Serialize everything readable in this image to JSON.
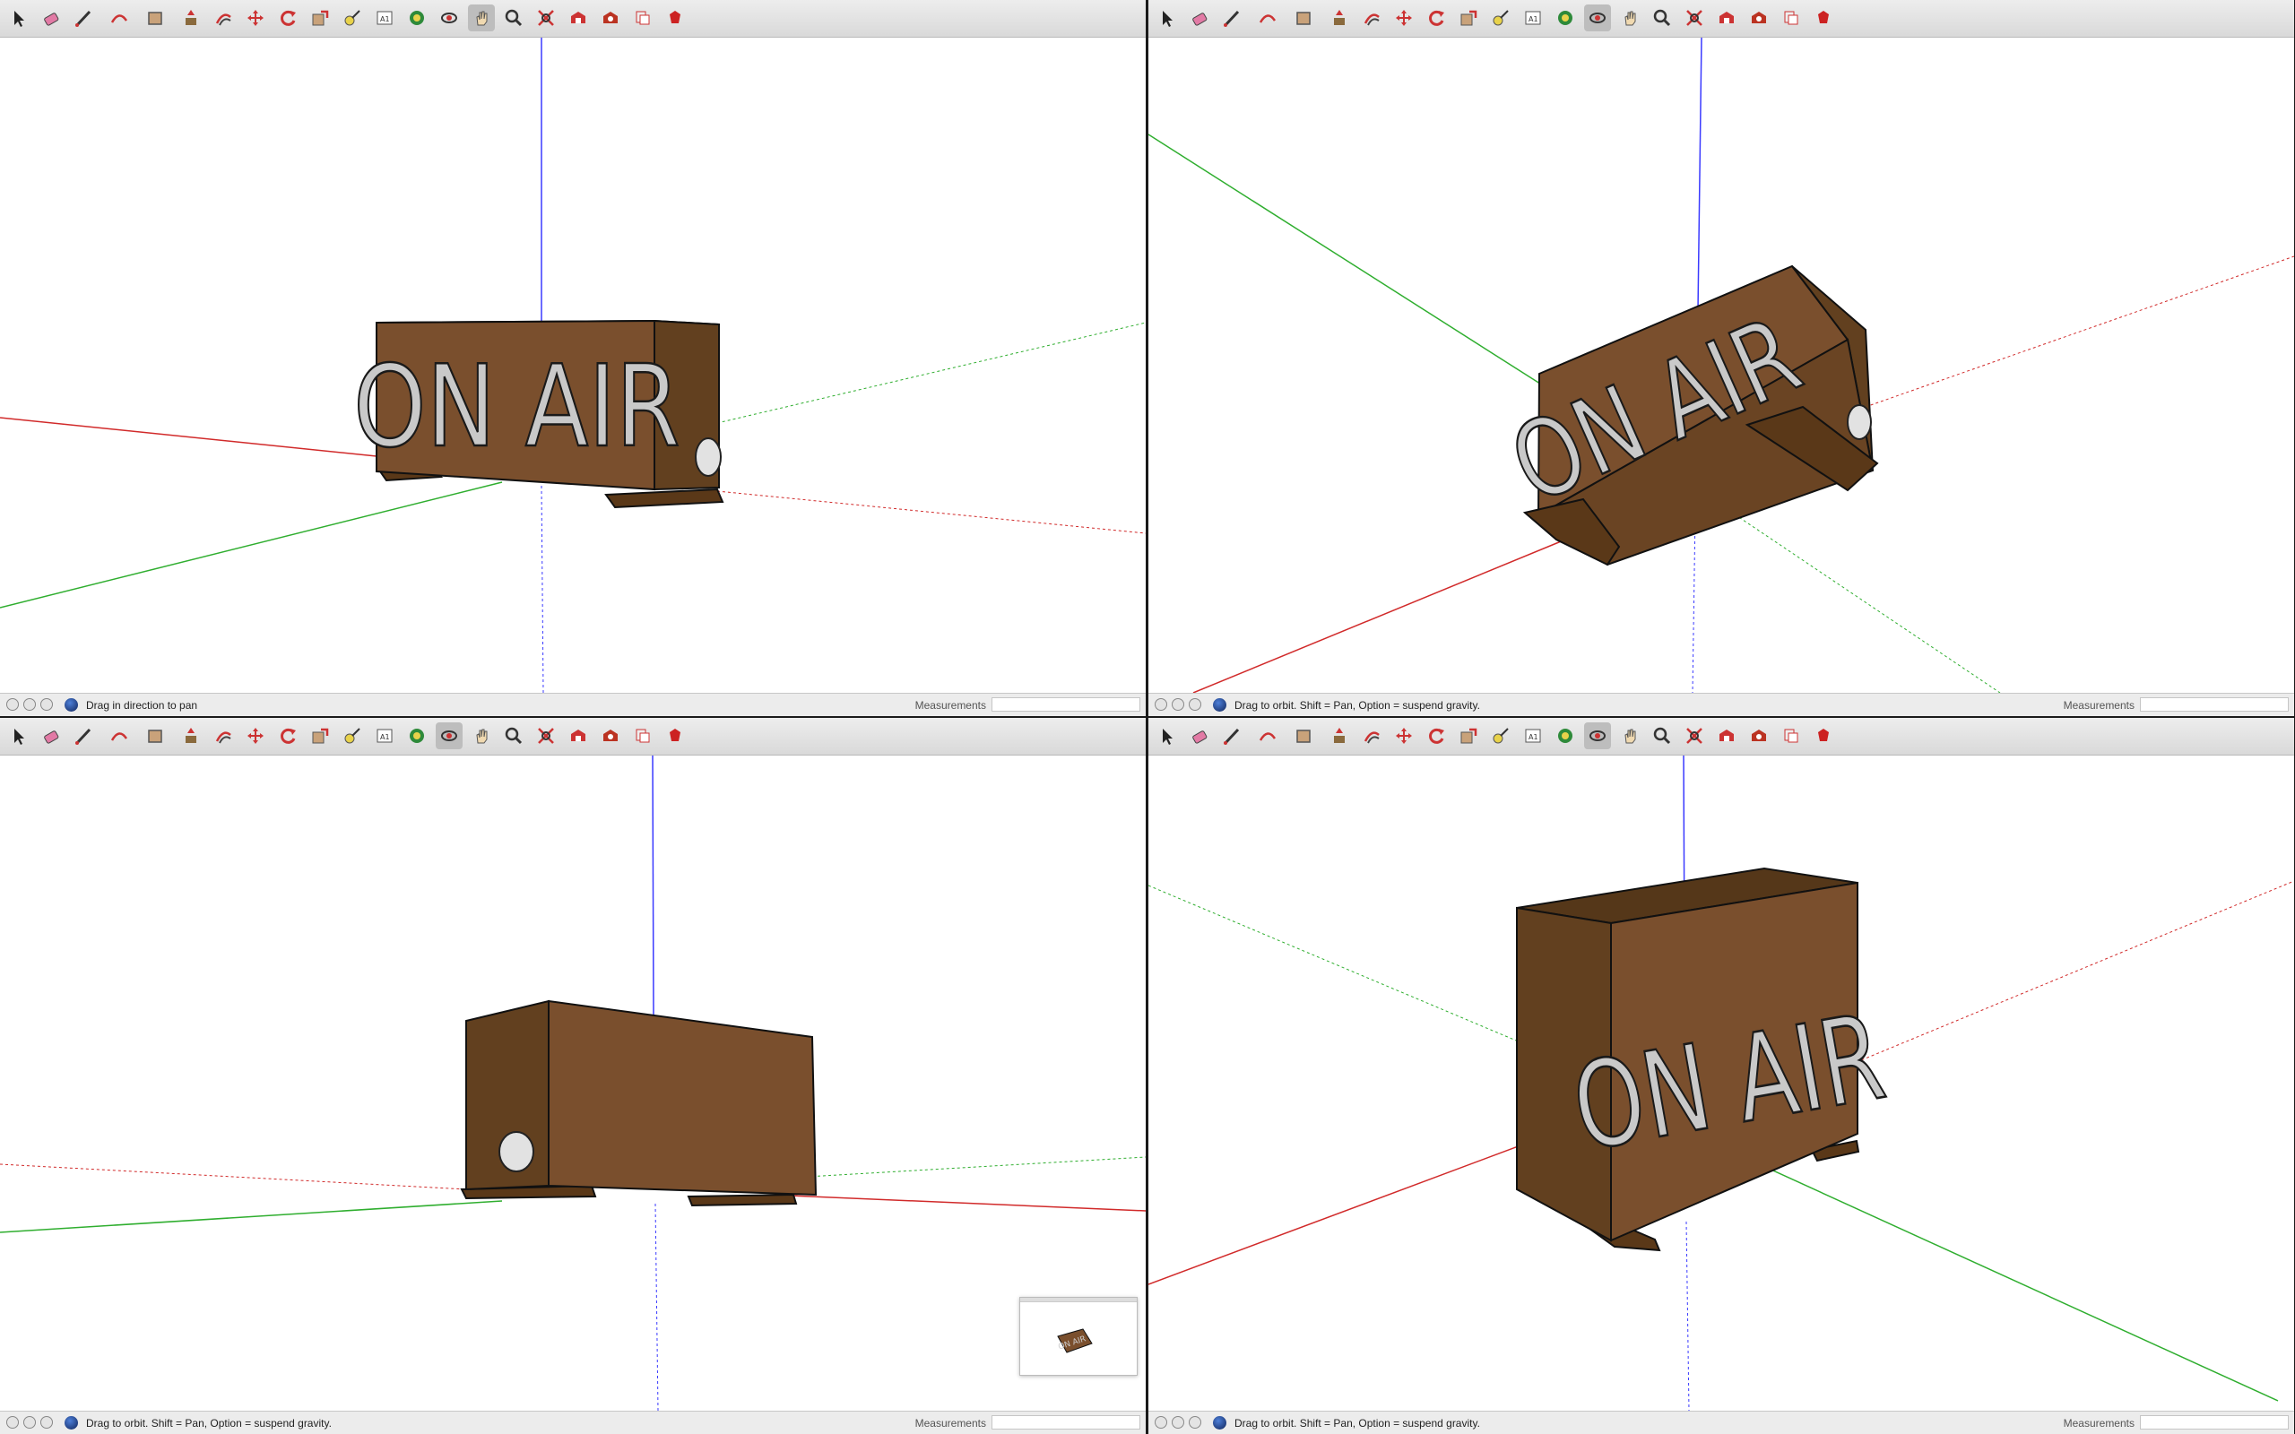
{
  "toolbar": {
    "tools": [
      {
        "name": "select-tool",
        "label": "Select"
      },
      {
        "name": "eraser-tool",
        "label": "Eraser"
      },
      {
        "name": "line-tool",
        "label": "Line"
      },
      {
        "name": "arc-tool",
        "label": "Arc"
      },
      {
        "name": "shape-tool",
        "label": "Rectangle"
      },
      {
        "name": "push-pull-tool",
        "label": "Push/Pull"
      },
      {
        "name": "offset-tool",
        "label": "Offset"
      },
      {
        "name": "move-tool",
        "label": "Move"
      },
      {
        "name": "rotate-tool",
        "label": "Rotate"
      },
      {
        "name": "scale-tool",
        "label": "Scale"
      },
      {
        "name": "tape-measure-tool",
        "label": "Tape Measure"
      },
      {
        "name": "text-tool",
        "label": "Text"
      },
      {
        "name": "paint-bucket-tool",
        "label": "Paint Bucket"
      },
      {
        "name": "orbit-tool",
        "label": "Orbit"
      },
      {
        "name": "pan-tool",
        "label": "Pan"
      },
      {
        "name": "zoom-tool",
        "label": "Zoom"
      },
      {
        "name": "zoom-extents-tool",
        "label": "Zoom Extents"
      },
      {
        "name": "warehouse-tool",
        "label": "3D Warehouse"
      },
      {
        "name": "extension-warehouse-tool",
        "label": "Extension Warehouse"
      },
      {
        "name": "layout-tool",
        "label": "Send to LayOut"
      },
      {
        "name": "ruby-tool",
        "label": "Extension Manager"
      }
    ]
  },
  "model": {
    "sign_text": "ON AIR",
    "colors": {
      "box_front": "#7a4f2d",
      "box_side": "#62401f",
      "box_top": "#553719",
      "text_fill": "#c9c9c9",
      "axis_red": "#d12a2a",
      "axis_green": "#2fae2f",
      "axis_blue": "#3a3aff"
    }
  },
  "panes": [
    {
      "id": "top-left",
      "active_tool": "pan",
      "status": "Drag in direction to pan",
      "measurements_label": "Measurements",
      "measurements_value": ""
    },
    {
      "id": "top-right",
      "active_tool": "orbit",
      "status": "Drag to orbit. Shift = Pan, Option = suspend gravity.",
      "measurements_label": "Measurements",
      "measurements_value": ""
    },
    {
      "id": "bottom-left",
      "active_tool": "orbit",
      "status": "Drag to orbit. Shift = Pan, Option = suspend gravity.",
      "measurements_label": "Measurements",
      "measurements_value": ""
    },
    {
      "id": "bottom-right",
      "active_tool": "orbit",
      "status": "Drag to orbit. Shift = Pan, Option = suspend gravity.",
      "measurements_label": "Measurements",
      "measurements_value": ""
    }
  ]
}
